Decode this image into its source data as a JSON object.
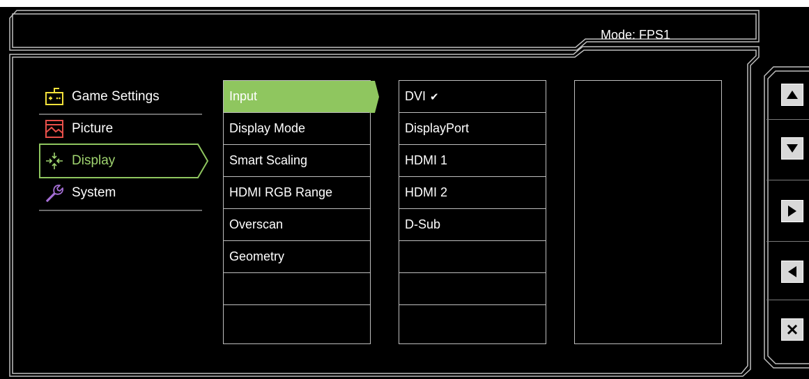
{
  "header": {
    "mode_label": "Mode: FPS1"
  },
  "main_menu": {
    "items": [
      {
        "label": "Game Settings",
        "icon": "gamepad-icon",
        "selected": false
      },
      {
        "label": "Picture",
        "icon": "picture-icon",
        "selected": false
      },
      {
        "label": "Display",
        "icon": "display-icon",
        "selected": true
      },
      {
        "label": "System",
        "icon": "wrench-icon",
        "selected": false
      }
    ]
  },
  "submenu": {
    "items": [
      "Input",
      "Display Mode",
      "Smart Scaling",
      "HDMI RGB Range",
      "Overscan",
      "Geometry",
      "",
      ""
    ],
    "active_index": 0
  },
  "options": {
    "items": [
      "DVI",
      "DisplayPort",
      "HDMI 1",
      "HDMI 2",
      "D-Sub",
      "",
      "",
      ""
    ],
    "checked_index": 0,
    "check_glyph": "✔"
  },
  "nav_buttons": [
    {
      "icon": "up-arrow-icon"
    },
    {
      "icon": "down-arrow-icon"
    },
    {
      "icon": "right-arrow-icon"
    },
    {
      "icon": "left-arrow-icon"
    },
    {
      "icon": "close-icon"
    }
  ],
  "colors": {
    "accent": "#8fc65f",
    "icon_yellow": "#f5e23a",
    "icon_red": "#e8504a",
    "icon_purple": "#a66fd6",
    "icon_green": "#9fd36f"
  }
}
